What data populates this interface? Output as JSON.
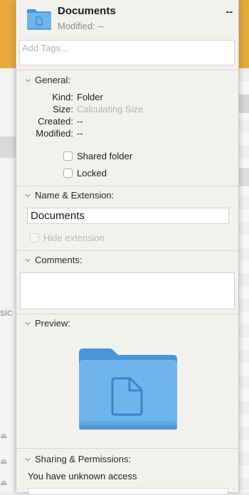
{
  "header": {
    "title": "Documents",
    "size": "--",
    "modified_label": "Modified: --"
  },
  "tags": {
    "placeholder": "Add Tags..."
  },
  "general": {
    "heading": "General:",
    "kind_label": "Kind:",
    "kind_value": "Folder",
    "size_label": "Size:",
    "size_value": "Calculating Size",
    "created_label": "Created:",
    "created_value": "--",
    "modified_label": "Modified:",
    "modified_value": "--",
    "shared_folder_label": "Shared folder",
    "locked_label": "Locked"
  },
  "name_extension": {
    "heading": "Name & Extension:",
    "name_value": "Documents",
    "hide_extension_label": "Hide extension"
  },
  "comments": {
    "heading": "Comments:"
  },
  "preview": {
    "heading": "Preview:"
  },
  "sharing": {
    "heading": "Sharing & Permissions:",
    "access_text": "You have unknown access"
  },
  "background": {
    "partial_text": "sic"
  },
  "colors": {
    "folder_blue": "#6eb5ee",
    "folder_dark": "#4a95d6",
    "accent_orange": "#e7a93c"
  }
}
